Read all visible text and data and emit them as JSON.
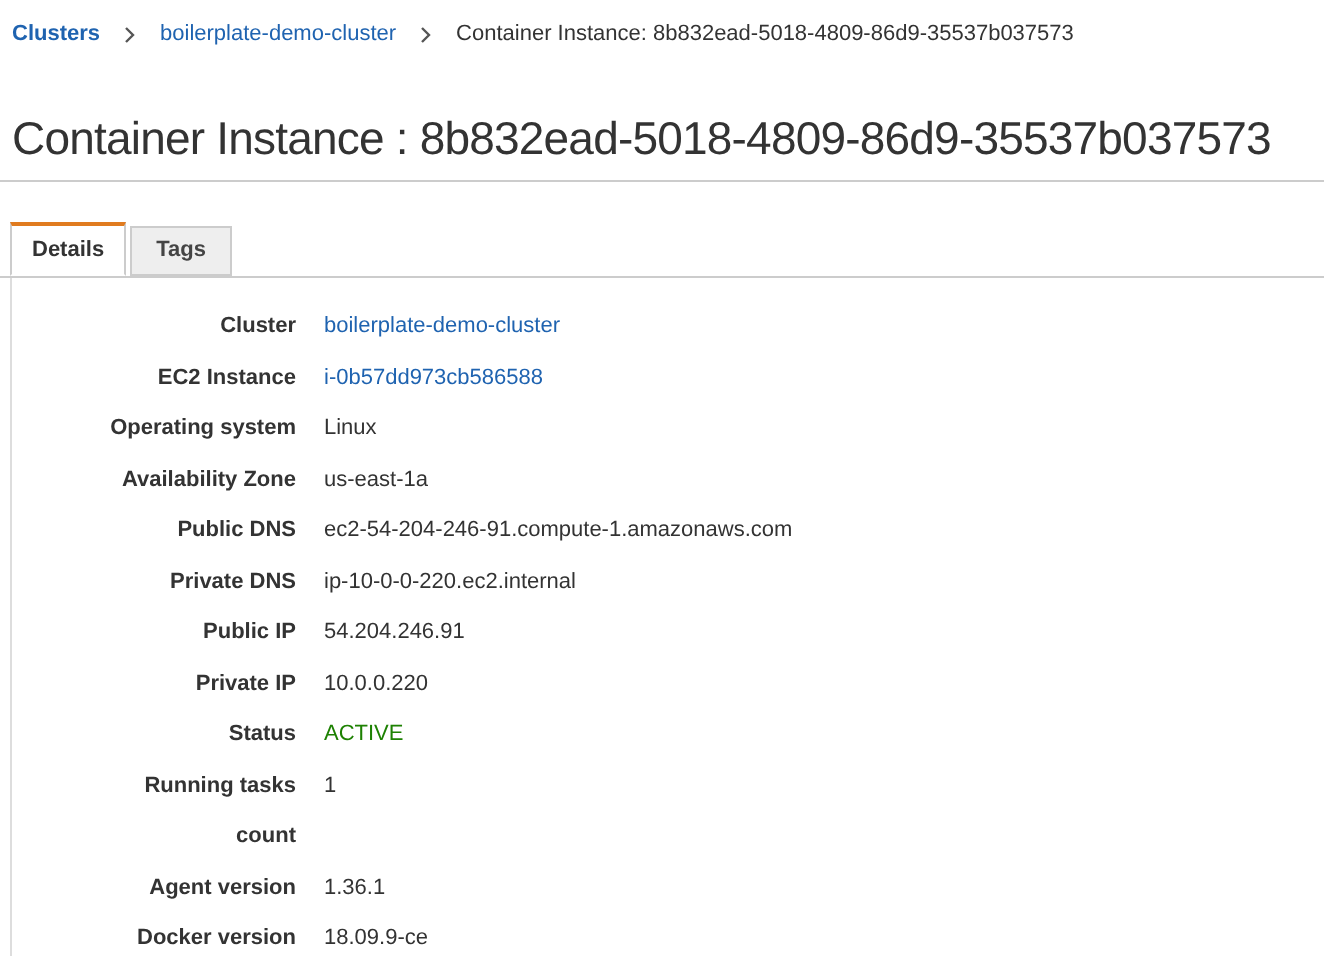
{
  "breadcrumb": [
    {
      "label": "Clusters",
      "kind": "link",
      "bold": true
    },
    {
      "label": "boilerplate-demo-cluster",
      "kind": "link",
      "bold": false
    },
    {
      "label": "Container Instance: 8b832ead-5018-4809-86d9-35537b037573",
      "kind": "current",
      "bold": false
    }
  ],
  "title": "Container Instance : 8b832ead-5018-4809-86d9-35537b037573",
  "tabs": [
    {
      "label": "Details",
      "selected": true
    },
    {
      "label": "Tags",
      "selected": false
    }
  ],
  "details": [
    {
      "label": "Cluster",
      "value": "boilerplate-demo-cluster",
      "kind": "link"
    },
    {
      "label": "EC2 Instance",
      "value": "i-0b57dd973cb586588",
      "kind": "link"
    },
    {
      "label": "Operating system",
      "value": "Linux",
      "kind": "text"
    },
    {
      "label": "Availability Zone",
      "value": "us-east-1a",
      "kind": "text"
    },
    {
      "label": "Public DNS",
      "value": "ec2-54-204-246-91.compute-1.amazonaws.com",
      "kind": "text"
    },
    {
      "label": "Private DNS",
      "value": "ip-10-0-0-220.ec2.internal",
      "kind": "text"
    },
    {
      "label": "Public IP",
      "value": "54.204.246.91",
      "kind": "text"
    },
    {
      "label": "Private IP",
      "value": "10.0.0.220",
      "kind": "text"
    },
    {
      "label": "Status",
      "value": "ACTIVE",
      "kind": "status"
    },
    {
      "label": "Running tasks count",
      "value": "1",
      "kind": "text"
    },
    {
      "label": "Agent version",
      "value": "1.36.1",
      "kind": "text"
    },
    {
      "label": "Docker version",
      "value": "18.09.9-ce",
      "kind": "text"
    }
  ]
}
